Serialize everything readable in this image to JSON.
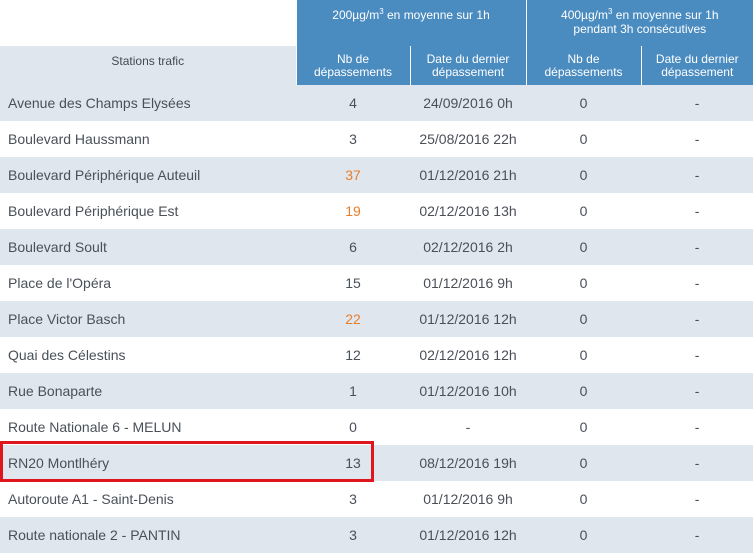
{
  "header": {
    "group1_before": "200µg/m",
    "group1_sup": "3",
    "group1_after": " en moyenne sur 1h",
    "group2_before": "400µg/m",
    "group2_sup": "3",
    "group2_after": " en moyenne sur 1h",
    "group2_line2": "pendant 3h consécutives",
    "stations_label": "Stations trafic",
    "nb_line1": "Nb de",
    "nb_line2": "dépassements",
    "date_line1": "Date du dernier",
    "date_line2": "dépassement"
  },
  "colors": {
    "header_blue": "#4a8bc0",
    "row_band": "#dfe6ee",
    "highlight_value": "#e87f2c",
    "annotation_box": "#e0161f"
  },
  "rows": [
    {
      "station": "Avenue des Champs Elysées",
      "nb1": "4",
      "date1": "24/09/2016  0h",
      "nb2": "0",
      "date2": "-",
      "orange": false
    },
    {
      "station": "Boulevard Haussmann",
      "nb1": "3",
      "date1": "25/08/2016 22h",
      "nb2": "0",
      "date2": "-",
      "orange": false
    },
    {
      "station": "Boulevard Périphérique Auteuil",
      "nb1": "37",
      "date1": "01/12/2016 21h",
      "nb2": "0",
      "date2": "-",
      "orange": true
    },
    {
      "station": "Boulevard Périphérique Est",
      "nb1": "19",
      "date1": "02/12/2016 13h",
      "nb2": "0",
      "date2": "-",
      "orange": true
    },
    {
      "station": "Boulevard Soult",
      "nb1": "6",
      "date1": "02/12/2016  2h",
      "nb2": "0",
      "date2": "-",
      "orange": false
    },
    {
      "station": "Place de l'Opéra",
      "nb1": "15",
      "date1": "01/12/2016  9h",
      "nb2": "0",
      "date2": "-",
      "orange": false
    },
    {
      "station": "Place Victor Basch",
      "nb1": "22",
      "date1": "01/12/2016 12h",
      "nb2": "0",
      "date2": "-",
      "orange": true
    },
    {
      "station": "Quai des Célestins",
      "nb1": "12",
      "date1": "02/12/2016 12h",
      "nb2": "0",
      "date2": "-",
      "orange": false
    },
    {
      "station": "Rue Bonaparte",
      "nb1": "1",
      "date1": "01/12/2016 10h",
      "nb2": "0",
      "date2": "-",
      "orange": false
    },
    {
      "station": "Route Nationale 6 - MELUN",
      "nb1": "0",
      "date1": "-",
      "nb2": "0",
      "date2": "-",
      "orange": false
    },
    {
      "station": "RN20 Montlhéry",
      "nb1": "13",
      "date1": "08/12/2016 19h",
      "nb2": "0",
      "date2": "-",
      "orange": false
    },
    {
      "station": "Autoroute A1 - Saint-Denis",
      "nb1": "3",
      "date1": "01/12/2016  9h",
      "nb2": "0",
      "date2": "-",
      "orange": false
    },
    {
      "station": "Route nationale 2 - PANTIN",
      "nb1": "3",
      "date1": "01/12/2016 12h",
      "nb2": "0",
      "date2": "-",
      "orange": false
    }
  ]
}
